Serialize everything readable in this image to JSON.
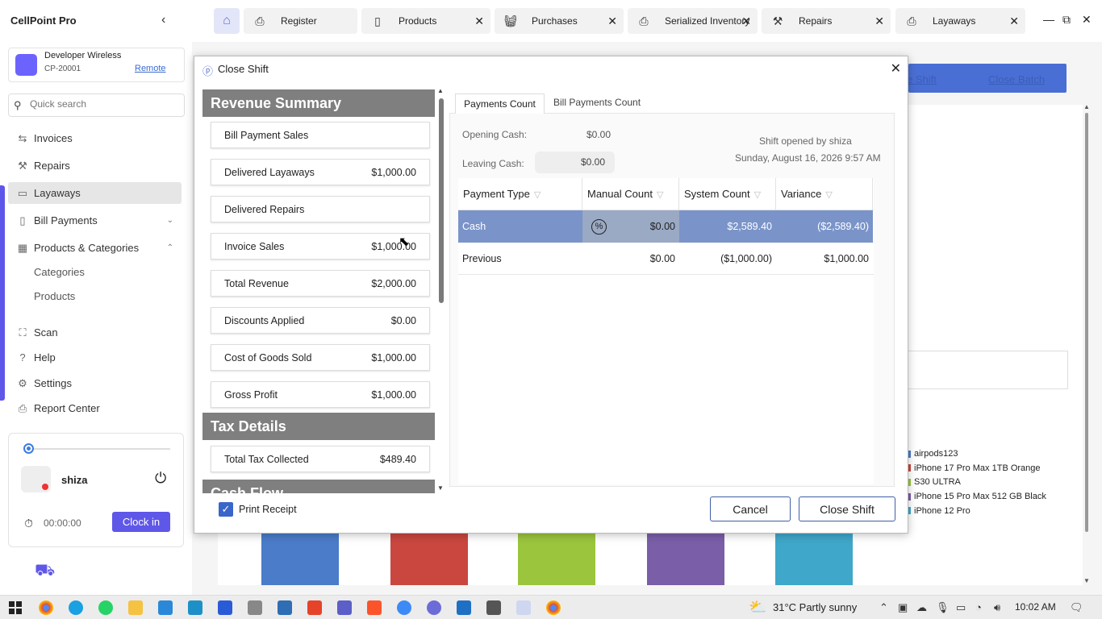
{
  "app": {
    "title": "CellPoint Pro"
  },
  "store": {
    "name": "Developer Wireless",
    "id": "CP-20001",
    "remote_label": "Remote"
  },
  "search": {
    "placeholder": "Quick search"
  },
  "nav": {
    "invoices": "Invoices",
    "repairs": "Repairs",
    "layaways": "Layaways",
    "bill_payments": "Bill Payments",
    "products_categories": "Products & Categories",
    "categories": "Categories",
    "products": "Products",
    "scan": "Scan",
    "help": "Help",
    "settings": "Settings",
    "report_center": "Report Center"
  },
  "user": {
    "name": "shiza",
    "timer": "00:00:00",
    "clock_in_label": "Clock in"
  },
  "tabs": [
    {
      "label": "Register",
      "icon": "printer-icon"
    },
    {
      "label": "Products",
      "icon": "tablet-icon"
    },
    {
      "label": "Purchases",
      "icon": "basket-icon"
    },
    {
      "label": "Serialized Inventory",
      "icon": "printer-icon"
    },
    {
      "label": "Repairs",
      "icon": "tools-icon"
    },
    {
      "label": "Layaways",
      "icon": "printer-icon"
    }
  ],
  "background": {
    "link1": "e Shift",
    "link2": "Close Batch",
    "legend": [
      "airpods123",
      "iPhone 17 Pro Max 1TB Orange",
      "S30 ULTRA",
      "iPhone 15 Pro Max 512 GB Black",
      "iPhone 12 Pro"
    ],
    "legend_colors": [
      "#4a7cc9",
      "#c9473f",
      "#9bc53d",
      "#7a5ea8",
      "#3fa7c9"
    ]
  },
  "dialog": {
    "title": "Close Shift",
    "revenue_header": "Revenue Summary",
    "revenue": [
      {
        "label": "Bill Payment Sales",
        "value": ""
      },
      {
        "label": "Delivered Layaways",
        "value": "$1,000.00"
      },
      {
        "label": "Delivered Repairs",
        "value": ""
      },
      {
        "label": "Invoice Sales",
        "value": "$1,000.00"
      },
      {
        "label": "Total Revenue",
        "value": "$2,000.00"
      },
      {
        "label": "Discounts Applied",
        "value": "$0.00"
      },
      {
        "label": "Cost of Goods Sold",
        "value": "$1,000.00"
      },
      {
        "label": "Gross Profit",
        "value": "$1,000.00"
      }
    ],
    "tax_header": "Tax Details",
    "tax": [
      {
        "label": "Total Tax Collected",
        "value": "$489.40"
      }
    ],
    "cashflow_header": "Cash Flow",
    "print_receipt": "Print Receipt",
    "tab_payments": "Payments Count",
    "tab_bill_payments": "Bill Payments Count",
    "opening_cash_label": "Opening Cash:",
    "opening_cash": "$0.00",
    "leaving_cash_label": "Leaving Cash:",
    "leaving_cash": "$0.00",
    "shift_opened_by": "Shift opened by shiza",
    "shift_date": "Sunday, August 16, 2026 9:57 AM",
    "columns": [
      "Payment Type",
      "Manual Count",
      "System Count",
      "Variance"
    ],
    "rows": [
      {
        "type": "Cash",
        "manual": "$0.00",
        "system": "$2,589.40",
        "variance": "($2,589.40)"
      },
      {
        "type": "Previous",
        "manual": "$0.00",
        "system": "($1,000.00)",
        "variance": "$1,000.00"
      }
    ],
    "cancel_label": "Cancel",
    "close_shift_label": "Close Shift"
  },
  "taskbar": {
    "weather": "31°C  Partly sunny",
    "time": "10:02 AM"
  }
}
